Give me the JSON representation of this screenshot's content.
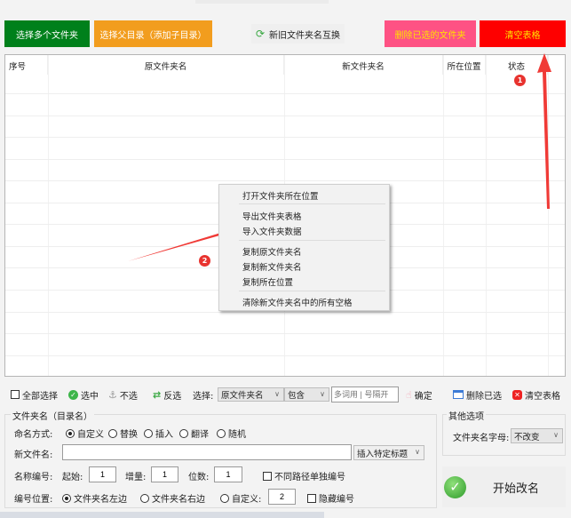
{
  "toolbar": {
    "select_multiple": "选择多个文件夹",
    "select_parent": "选择父目录（添加子目录）",
    "swap_names": "新旧文件夹名互换",
    "delete_selected": "删除已选的文件夹",
    "clear_table": "清空表格"
  },
  "colors": {
    "green": "#00801b",
    "orange": "#f29d1e",
    "pink": "#fe5284",
    "red": "#fe0000",
    "yellow_text": "#ffe100",
    "annotation": "#e8332f"
  },
  "table": {
    "columns": [
      "序号",
      "原文件夹名",
      "新文件夹名",
      "所在位置",
      "状态"
    ],
    "rows": []
  },
  "context_menu": {
    "items": [
      "打开文件夹所在位置",
      "导出文件夹表格",
      "导入文件夹数据",
      "复制原文件夹名",
      "复制新文件夹名",
      "复制所在位置",
      "清除新文件夹名中的所有空格"
    ]
  },
  "annotations": {
    "badge1": "1",
    "badge2": "2"
  },
  "selection_bar": {
    "select_all": "全部选择",
    "select": "选中",
    "deselect": "不选",
    "invert": "反选",
    "choose_label": "选择:",
    "field_select": "原文件夹名",
    "match_select": "包含",
    "keyword_placeholder": "多词用 | 号隔开",
    "confirm": "确定",
    "delete_selected": "删除已选",
    "clear_table": "清空表格"
  },
  "folder_name_group": {
    "title": "文件夹名（目录名）",
    "naming_label": "命名方式:",
    "naming_options": [
      "自定义",
      "替换",
      "插入",
      "翻译",
      "随机"
    ],
    "naming_selected": "自定义",
    "new_name_label": "新文件名:",
    "new_name_value": "",
    "insert_title_select": "插入特定标题",
    "numbering_label": "名称编号:",
    "start_label": "起始:",
    "start_value": "1",
    "increment_label": "增量:",
    "increment_value": "1",
    "digits_label": "位数:",
    "digits_value": "1",
    "separate_numbering": "不同路径单独编号",
    "position_label": "编号位置:",
    "position_options": [
      "文件夹名左边",
      "文件夹名右边",
      "自定义:"
    ],
    "position_selected": "文件夹名左边",
    "custom_position_value": "2",
    "hide_numbering": "隐藏编号"
  },
  "other_options": {
    "title": "其他选项",
    "letter_case_label": "文件夹名字母:",
    "letter_case_value": "不改变"
  },
  "start_button": "开始改名"
}
